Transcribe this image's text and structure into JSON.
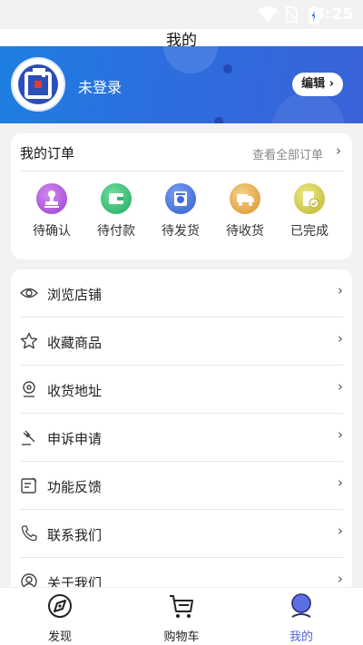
{
  "status_bar": {
    "time": "8:25",
    "icons": [
      "wifi-icon",
      "no-sim-icon",
      "battery-icon"
    ]
  },
  "nav": {
    "title": "我的"
  },
  "profile": {
    "login_text": "未登录",
    "edit_label": "编辑",
    "edit_chevron": "›"
  },
  "orders": {
    "title": "我的订单",
    "view_all": "查看全部订单",
    "chevron": "›",
    "items": [
      {
        "label": "待确认",
        "icon": "stamp-icon",
        "color": "#a24fd6"
      },
      {
        "label": "待付款",
        "icon": "wallet-icon",
        "color": "#2ebd6b"
      },
      {
        "label": "待发货",
        "icon": "box-clock-icon",
        "color": "#3a6bd8"
      },
      {
        "label": "待收货",
        "icon": "truck-icon",
        "color": "#e2a33c"
      },
      {
        "label": "已完成",
        "icon": "check-doc-icon",
        "color": "#c9c23a"
      }
    ]
  },
  "menu": {
    "chevron": "›",
    "items": [
      {
        "label": "浏览店铺",
        "icon": "eye-icon"
      },
      {
        "label": "收藏商品",
        "icon": "star-icon"
      },
      {
        "label": "收货地址",
        "icon": "location-icon"
      },
      {
        "label": "申诉申请",
        "icon": "gavel-icon"
      },
      {
        "label": "功能反馈",
        "icon": "feedback-icon"
      },
      {
        "label": "联系我们",
        "icon": "phone-icon"
      },
      {
        "label": "关于我们",
        "icon": "about-icon"
      }
    ]
  },
  "tabs": [
    {
      "label": "发现",
      "icon": "discover-icon"
    },
    {
      "label": "购物车",
      "icon": "cart-icon"
    },
    {
      "label": "我的",
      "icon": "profile-icon",
      "active": true
    }
  ],
  "colors": {
    "accent": "#5564d8",
    "banner": "#2b6fe0"
  }
}
